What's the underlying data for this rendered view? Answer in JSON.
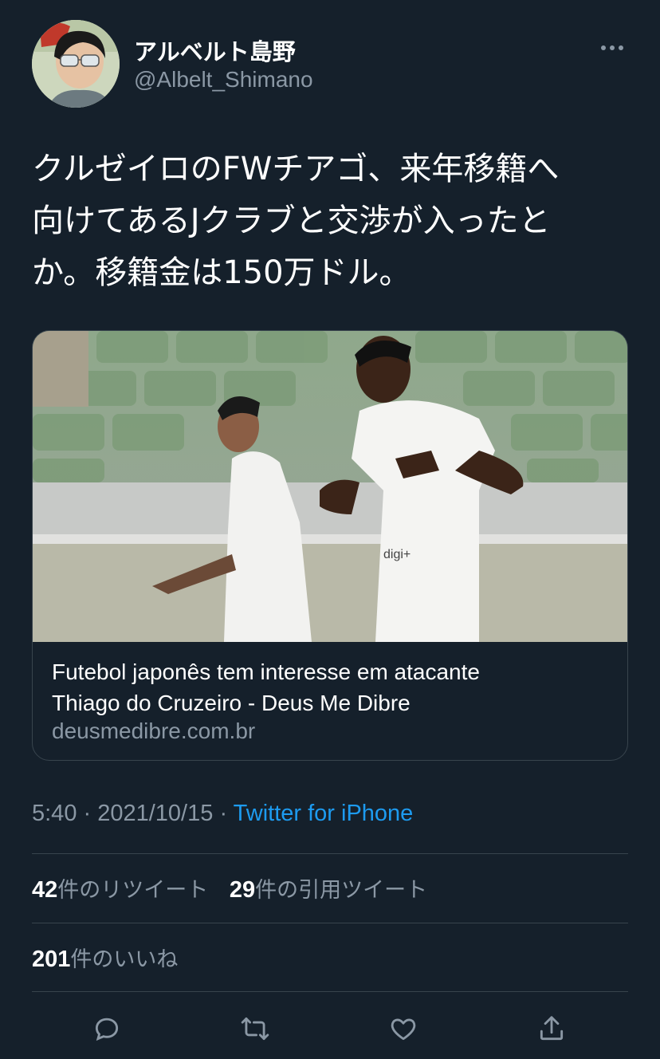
{
  "user": {
    "display_name": "アルベルト島野",
    "handle": "@Albelt_Shimano"
  },
  "tweet": {
    "text": "クルゼイロのFWチアゴ、来年移籍へ向けてあるJクラブと交渉が入ったとか。移籍金は150万ドル。",
    "lines": [
      "クルゼイロのFWチアゴ、来年移籍へ",
      "向けてあるJクラブと交渉が入ったと",
      "か。移籍金は150万ドル。"
    ]
  },
  "card": {
    "title_lines": [
      "Futebol japonês tem interesse em atacante",
      "Thiago do Cruzeiro - Deus Me Dibre"
    ],
    "domain": "deusmedibre.com.br"
  },
  "meta": {
    "time": "5:40",
    "separator": " · ",
    "date": "2021/10/15",
    "source": "Twitter for iPhone"
  },
  "stats": {
    "retweets_count": "42",
    "retweets_label": "件のリツイート",
    "quotes_count": "29",
    "quotes_label": "件の引用ツイート",
    "likes_count": "201",
    "likes_label": "件のいいね"
  },
  "icons": {
    "more": "more-icon",
    "reply": "reply-icon",
    "retweet": "retweet-icon",
    "like": "like-icon",
    "share": "share-icon"
  },
  "colors": {
    "background": "#15202b",
    "secondary_text": "#8b98a5",
    "link": "#1d9bf0",
    "divider": "#38444d"
  }
}
